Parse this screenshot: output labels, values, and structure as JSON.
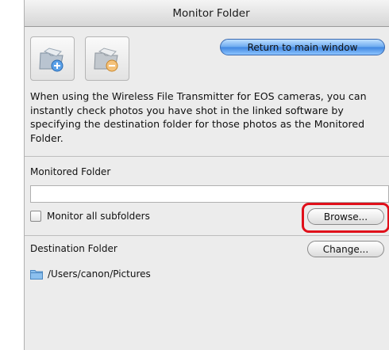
{
  "window": {
    "title": "Monitor Folder"
  },
  "toolbar": {
    "return_label": "Return to main window"
  },
  "description": "When using the Wireless File Transmitter for EOS cameras, you can instantly check photos you have shot in the linked software by specifying the destination folder for those photos as the Monitored Folder.",
  "monitored": {
    "label": "Monitored Folder",
    "value": "",
    "subfolders_label": "Monitor all subfolders",
    "subfolders_checked": false,
    "browse_label": "Browse..."
  },
  "destination": {
    "label": "Destination Folder",
    "change_label": "Change...",
    "path": "/Users/canon/Pictures"
  },
  "icons": {
    "add_folder": "add-monitored-folder-icon",
    "remove_folder": "remove-monitored-folder-icon",
    "folder": "folder-icon"
  },
  "colors": {
    "highlight": "#e0101a",
    "accent": "#3f86e0"
  }
}
